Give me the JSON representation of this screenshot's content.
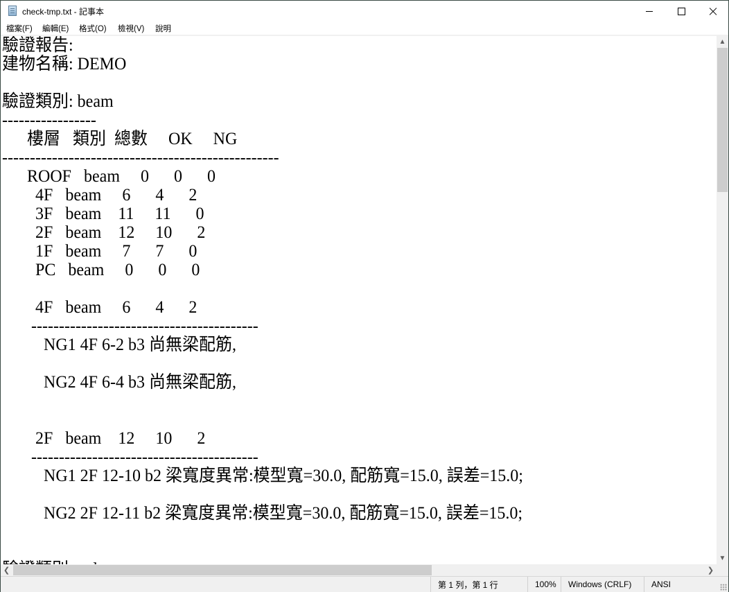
{
  "window": {
    "title": "check-tmp.txt - 記事本",
    "icon": "notepad-icon",
    "controls": {
      "minimize": "minimize-icon",
      "maximize": "maximize-icon",
      "close": "close-icon"
    }
  },
  "menu": [
    {
      "label": "檔案(F)"
    },
    {
      "label": "編輯(E)"
    },
    {
      "label": "格式(O)"
    },
    {
      "label": "檢視(V)"
    },
    {
      "label": "說明"
    }
  ],
  "document": {
    "lines": [
      "驗證報告:",
      "建物名稱: DEMO",
      "",
      "驗證類別: beam",
      "-----------------",
      "      樓層   類別  總數     OK     NG",
      "--------------------------------------------------",
      "      ROOF   beam     0      0      0",
      "        4F   beam     6      4      2",
      "        3F   beam    11     11      0",
      "        2F   beam    12     10      2",
      "        1F   beam     7      7      0",
      "        PC   beam     0      0      0",
      "",
      "        4F   beam     6      4      2",
      "       -----------------------------------------",
      "          NG1 4F 6-2 b3 尚無梁配筋,",
      "",
      "          NG2 4F 6-4 b3 尚無梁配筋,",
      "",
      "",
      "        2F   beam    12     10      2",
      "       -----------------------------------------",
      "          NG1 2F 12-10 b2 梁寬度異常:模型寬=30.0, 配筋寬=15.0, 誤差=15.0;",
      "",
      "          NG2 2F 12-11 b2 梁寬度異常:模型寬=30.0, 配筋寬=15.0, 誤差=15.0;",
      "",
      "",
      "驗證類別: column"
    ]
  },
  "report": {
    "heading": "驗證報告:",
    "building_name_label": "建物名稱:",
    "building_name": "DEMO",
    "category_label": "驗證類別:",
    "category": "beam",
    "table_headers": [
      "樓層",
      "類別",
      "總數",
      "OK",
      "NG"
    ],
    "table_rows": [
      [
        "ROOF",
        "beam",
        "0",
        "0",
        "0"
      ],
      [
        "4F",
        "beam",
        "6",
        "4",
        "2"
      ],
      [
        "3F",
        "beam",
        "11",
        "11",
        "0"
      ],
      [
        "2F",
        "beam",
        "12",
        "10",
        "2"
      ],
      [
        "1F",
        "beam",
        "7",
        "7",
        "0"
      ],
      [
        "PC",
        "beam",
        "0",
        "0",
        "0"
      ]
    ],
    "ng_sections": [
      {
        "row": [
          "4F",
          "beam",
          "6",
          "4",
          "2"
        ],
        "items": [
          "NG1 4F 6-2 b3 尚無梁配筋,",
          "NG2 4F 6-4 b3 尚無梁配筋,"
        ]
      },
      {
        "row": [
          "2F",
          "beam",
          "12",
          "10",
          "2"
        ],
        "items": [
          "NG1 2F 12-10 b2 梁寬度異常:模型寬=30.0, 配筋寬=15.0, 誤差=15.0;",
          "NG2 2F 12-11 b2 梁寬度異常:模型寬=30.0, 配筋寬=15.0, 誤差=15.0;"
        ]
      }
    ]
  },
  "status": {
    "position": "第 1 列，第 1 行",
    "zoom": "100%",
    "line_ending": "Windows (CRLF)",
    "encoding": "ANSI"
  },
  "scroll": {
    "vertical_position_fraction": 0.0,
    "horizontal_position_fraction": 0.0
  }
}
